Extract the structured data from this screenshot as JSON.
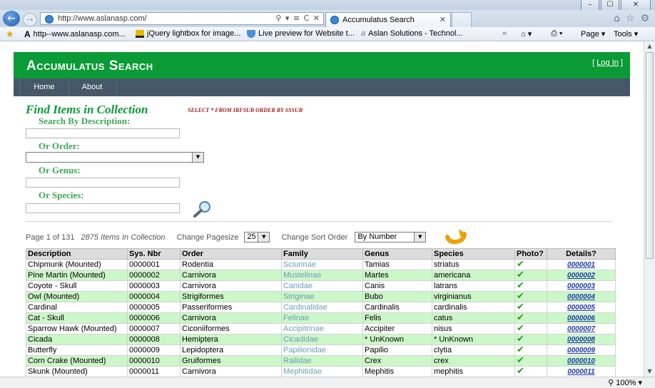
{
  "browser": {
    "window_buttons": [
      "–",
      "☐",
      "✕"
    ],
    "address": "http://www.aslanasp.com/",
    "tab_title": "Accumulatus Search",
    "favorites": [
      "http--www.aslanasp.com...",
      "jQuery lightbox for image...",
      "Live preview for Website t...",
      "Aslan Solutions - Technol..."
    ],
    "commands": {
      "page": "Page ▾",
      "tools": "Tools ▾"
    },
    "zoom": "100%"
  },
  "site": {
    "title": "Accumulatus Search",
    "login": {
      "open": "[ ",
      "link": "Log In",
      "close": " ]"
    },
    "menu": [
      "Home",
      "About"
    ],
    "heading": "Find Items in Collection",
    "sql": "SELECT * FROM IRFSUB ORDER BY SSSUB",
    "labels": {
      "description": "Search By Description:",
      "order": "Or Order:",
      "genus": "Or Genus:",
      "species": "Or Species:"
    },
    "pager": {
      "page": "Page 1 of 131",
      "count": "2875 Items In Collection",
      "pagesize_label": "Change Pagesize",
      "pagesize_value": "25",
      "sort_label": "Change Sort Order",
      "sort_value": "By Number"
    },
    "table": {
      "headers": [
        "Description",
        "Sys. Nbr",
        "Order",
        "Family",
        "Genus",
        "Species",
        "Photo?",
        "Details?"
      ],
      "rows": [
        [
          "Chipmunk (Mounted)",
          "0000001",
          "Rodentia",
          "Sciurinae",
          "Tamias",
          "striatus",
          "0000001"
        ],
        [
          "Pine Martin (Mounted)",
          "0000002",
          "Carnivora",
          "Mustelinae",
          "Martes",
          "americana",
          "0000002"
        ],
        [
          "Coyote - Skull",
          "0000003",
          "Carnivora",
          "Canidae",
          "Canis",
          "latrans",
          "0000003"
        ],
        [
          "Owl (Mounted)",
          "0000004",
          "Strigiformes",
          "Striginae",
          "Bubo",
          "virginianus",
          "0000004"
        ],
        [
          "Cardinal",
          "0000005",
          "Passeriformes",
          "Cardinalidae",
          "Cardinalis",
          "cardinalis",
          "0000005"
        ],
        [
          "Cat - Skull",
          "0000006",
          "Carnivora",
          "Felinae",
          "Felis",
          "catus",
          "0000006"
        ],
        [
          "Sparrow Hawk (Mounted)",
          "0000007",
          "Ciconiiformes",
          "Accipitrinae",
          "Accipiter",
          "nisus",
          "0000007"
        ],
        [
          "Cicada",
          "0000008",
          "Hemiptera",
          "Cicadidae",
          "* UnKnown",
          "* UnKnown",
          "0000008"
        ],
        [
          "Butterfly",
          "0000009",
          "Lepidoptera",
          "Papilionidae",
          "Papilio",
          "clytia",
          "0000009"
        ],
        [
          "Corn Crake (Mounted)",
          "0000010",
          "Gruiformes",
          "Rallidae",
          "Crex",
          "crex",
          "0000010"
        ],
        [
          "Skunk (Mounted)",
          "0000011",
          "Carnivora",
          "Mephitidae",
          "Mephitis",
          "mephitis",
          "0000011"
        ]
      ]
    }
  }
}
